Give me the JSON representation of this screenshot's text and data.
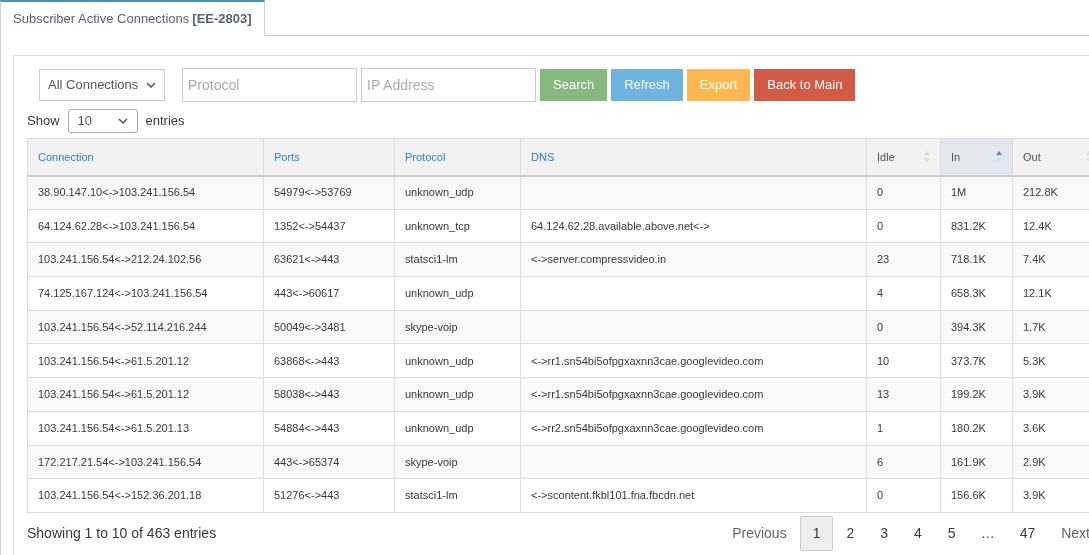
{
  "tab": {
    "title": "Subscriber Active Connections ",
    "code": "[EE-2803]",
    "selected": true
  },
  "filters": {
    "connection_type": "All Connections",
    "protocol": {
      "placeholder": "Protocol"
    },
    "ip_address": {
      "placeholder": "IP Address"
    }
  },
  "buttons": [
    {
      "label": "Search",
      "kind": "success"
    },
    {
      "label": "Refresh",
      "kind": "info"
    },
    {
      "label": "Export",
      "kind": "warning"
    },
    {
      "label": "Back to Main",
      "kind": "danger"
    }
  ],
  "length": {
    "before": "Show",
    "value": "10",
    "after": "entries"
  },
  "table": {
    "columns": [
      {
        "label": "Connection",
        "kind": "link"
      },
      {
        "label": "Ports",
        "kind": "link"
      },
      {
        "label": "Protocol",
        "kind": "link"
      },
      {
        "label": "DNS",
        "kind": "link"
      },
      {
        "label": "Idle",
        "kind": "sortable",
        "sorted": false
      },
      {
        "label": "In",
        "kind": "sortable",
        "sorted": true
      },
      {
        "label": "Out",
        "kind": "sortable",
        "sorted": false
      }
    ],
    "rows": [
      [
        "38.90.147.10<->103.241.156.54",
        "54979<->53769",
        "unknown_udp",
        "",
        "0",
        "1M",
        "212.8K"
      ],
      [
        "64.124.62.28<->103.241.156.54",
        "1352<->54437",
        "unknown_tcp",
        "64.124.62.28.available.above.net<->",
        "0",
        "831.2K",
        "12.4K"
      ],
      [
        "103.241.156.54<->212.24.102.56",
        "63621<->443",
        "statsci1-lm",
        "<->server.compressvideo.in",
        "23",
        "718.1K",
        "7.4K"
      ],
      [
        "74.125.167.124<->103.241.156.54",
        "443<->60617",
        "unknown_udp",
        "",
        "4",
        "658.3K",
        "12.1K"
      ],
      [
        "103.241.156.54<->52.114.216.244",
        "50049<->3481",
        "skype-voip",
        "",
        "0",
        "394.3K",
        "1.7K"
      ],
      [
        "103.241.156.54<->61.5.201.12",
        "63868<->443",
        "unknown_udp",
        "<->rr1.sn54bi5ofpgxaxnn3cae.googlevideo.com",
        "10",
        "373.7K",
        "5.3K"
      ],
      [
        "103.241.156.54<->61.5.201.12",
        "58038<->443",
        "unknown_udp",
        "<->rr1.sn54bi5ofpgxaxnn3cae.googlevideo.com",
        "13",
        "199.2K",
        "3.9K"
      ],
      [
        "103.241.156.54<->61.5.201.13",
        "54884<->443",
        "unknown_udp",
        "<->rr2.sn54bi5ofpgxaxnn3cae.googlevideo.com",
        "1",
        "180.2K",
        "3.6K"
      ],
      [
        "172.217.21.54<->103.241.156.54",
        "443<->65374",
        "skype-voip",
        "",
        "6",
        "161.9K",
        "2.9K"
      ],
      [
        "103.241.156.54<->152.36.201.18",
        "51276<->443",
        "statsci1-lm",
        "<->scontent.fkbl101.fna.fbcdn.net",
        "0",
        "156.6K",
        "3.9K"
      ]
    ]
  },
  "info": "Showing 1 to 10 of 463 entries",
  "pagination": [
    {
      "label": "Previous",
      "kind": "nav",
      "selected": false
    },
    {
      "label": "1",
      "kind": "page",
      "selected": true
    },
    {
      "label": "2",
      "kind": "page",
      "selected": false
    },
    {
      "label": "3",
      "kind": "page",
      "selected": false
    },
    {
      "label": "4",
      "kind": "page",
      "selected": false
    },
    {
      "label": "5",
      "kind": "page",
      "selected": false
    },
    {
      "label": "…",
      "kind": "ellipsis",
      "selected": false
    },
    {
      "label": "47",
      "kind": "page",
      "selected": false
    },
    {
      "label": "Next",
      "kind": "nav",
      "selected": false
    }
  ]
}
